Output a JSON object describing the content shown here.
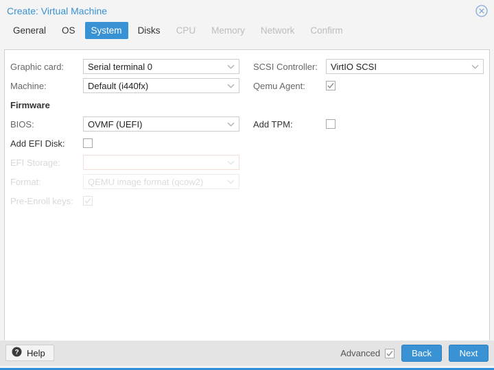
{
  "window": {
    "title": "Create: Virtual Machine",
    "close_icon": "close-circle-icon"
  },
  "tabs": [
    {
      "label": "General",
      "state": "enabled"
    },
    {
      "label": "OS",
      "state": "enabled"
    },
    {
      "label": "System",
      "state": "active"
    },
    {
      "label": "Disks",
      "state": "enabled"
    },
    {
      "label": "CPU",
      "state": "disabled"
    },
    {
      "label": "Memory",
      "state": "disabled"
    },
    {
      "label": "Network",
      "state": "disabled"
    },
    {
      "label": "Confirm",
      "state": "disabled"
    }
  ],
  "form": {
    "left": {
      "graphic_card": {
        "label": "Graphic card:",
        "value": "Serial terminal 0",
        "icon": "chevron-down-icon"
      },
      "machine": {
        "label": "Machine:",
        "value": "Default (i440fx)",
        "icon": "chevron-down-icon"
      },
      "firmware_header": "Firmware",
      "bios": {
        "label": "BIOS:",
        "value": "OVMF (UEFI)",
        "icon": "chevron-down-icon"
      },
      "add_efi_disk": {
        "label": "Add EFI Disk:",
        "checked": false
      },
      "efi_storage": {
        "label": "EFI Storage:",
        "value": "",
        "icon": "chevron-down-icon",
        "disabled": true,
        "invalid": true
      },
      "format": {
        "label": "Format:",
        "value": "QEMU image format (qcow2)",
        "icon": "chevron-down-icon",
        "disabled": true
      },
      "pre_enroll_keys": {
        "label": "Pre-Enroll keys:",
        "checked": true,
        "disabled": true
      }
    },
    "right": {
      "scsi_controller": {
        "label": "SCSI Controller:",
        "value": "VirtIO SCSI",
        "icon": "chevron-down-icon"
      },
      "qemu_agent": {
        "label": "Qemu Agent:",
        "checked": true
      },
      "add_tpm": {
        "label": "Add TPM:",
        "checked": false
      }
    }
  },
  "footer": {
    "help_label": "Help",
    "help_icon": "question-circle-icon",
    "advanced_label": "Advanced",
    "advanced_checked": true,
    "back_label": "Back",
    "next_label": "Next"
  },
  "colors": {
    "accent_blue": "#3892d4",
    "title_blue": "#3892d4",
    "footer_gray": "#e4e4e4",
    "invalid_border": "#f3ddd9"
  }
}
